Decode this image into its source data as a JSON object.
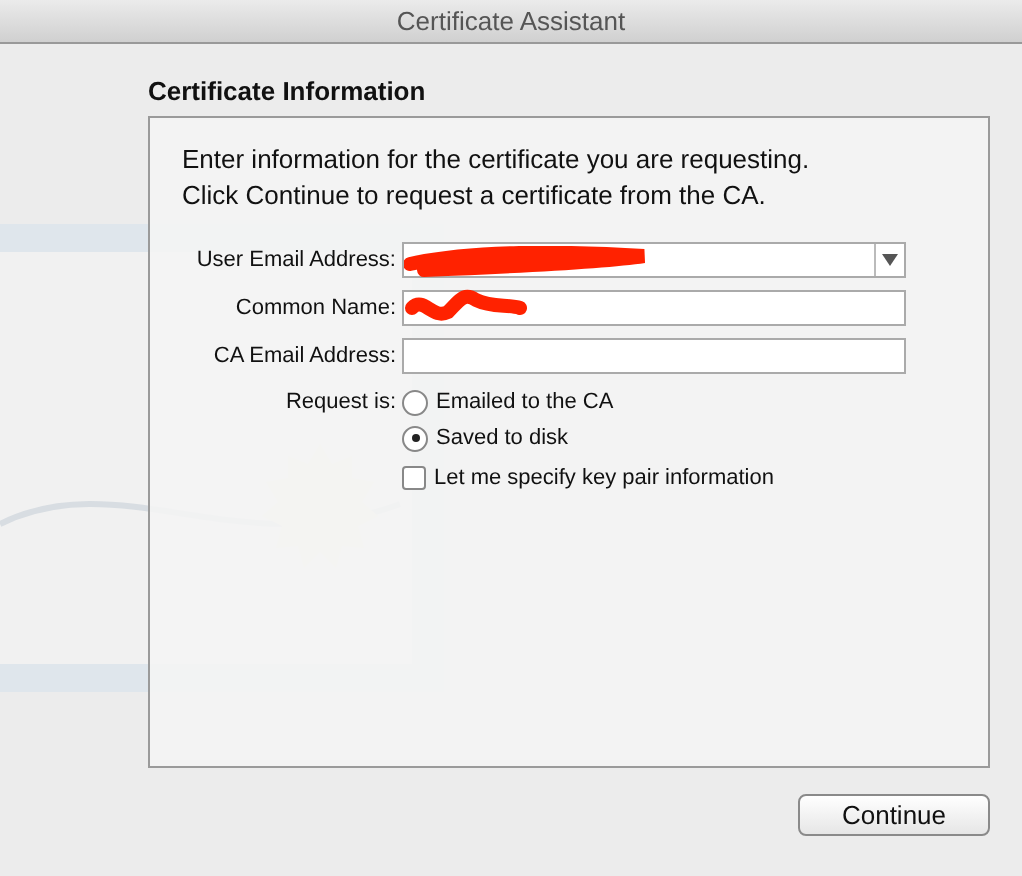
{
  "window": {
    "title": "Certificate Assistant"
  },
  "section_title": "Certificate Information",
  "intro": [
    "Enter information for the certificate you are requesting.",
    "Click Continue to request a certificate from the CA."
  ],
  "fields": [
    {
      "label": "User Email Address:",
      "kind": "combo",
      "redacted": true
    },
    {
      "label": "Common Name:",
      "kind": "text",
      "redacted": true
    },
    {
      "label": "CA Email Address:",
      "kind": "text",
      "redacted": false
    }
  ],
  "request": {
    "label": "Request is:",
    "options": [
      {
        "label": "Emailed to the CA",
        "selected": false
      },
      {
        "label": "Saved to disk",
        "selected": true
      }
    ]
  },
  "key_pair": {
    "label": "Let me specify key pair information",
    "checked": false
  },
  "buttons": [
    {
      "label": "Continue"
    }
  ]
}
